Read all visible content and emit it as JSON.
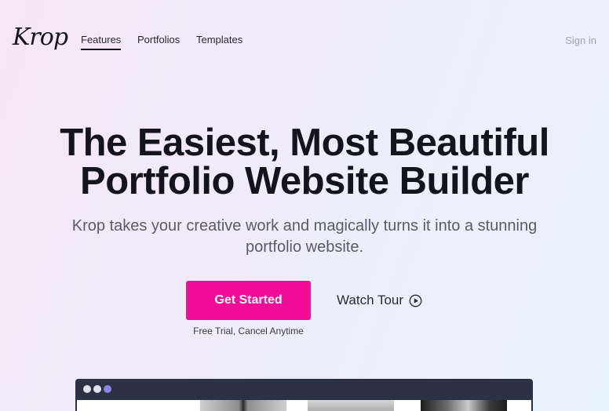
{
  "nav": {
    "logo": "Krop",
    "links": [
      {
        "label": "Features",
        "active": true
      },
      {
        "label": "Portfolios",
        "active": false
      },
      {
        "label": "Templates",
        "active": false
      }
    ],
    "signin": "Sign in"
  },
  "hero": {
    "title_line1": "The Easiest, Most Beautiful",
    "title_line2": "Portfolio Website Builder",
    "subtitle_line1": "Krop takes your creative work and magically turns it into a stunning",
    "subtitle_line2": "portfolio website.",
    "cta_label": "Get Started",
    "cta_note": "Free Trial, Cancel Anytime",
    "tour_label": "Watch Tour",
    "tour_icon": "play-circle-icon"
  },
  "colors": {
    "accent": "#f20c98",
    "text": "#14141f",
    "browser_bar": "#2c3146"
  }
}
